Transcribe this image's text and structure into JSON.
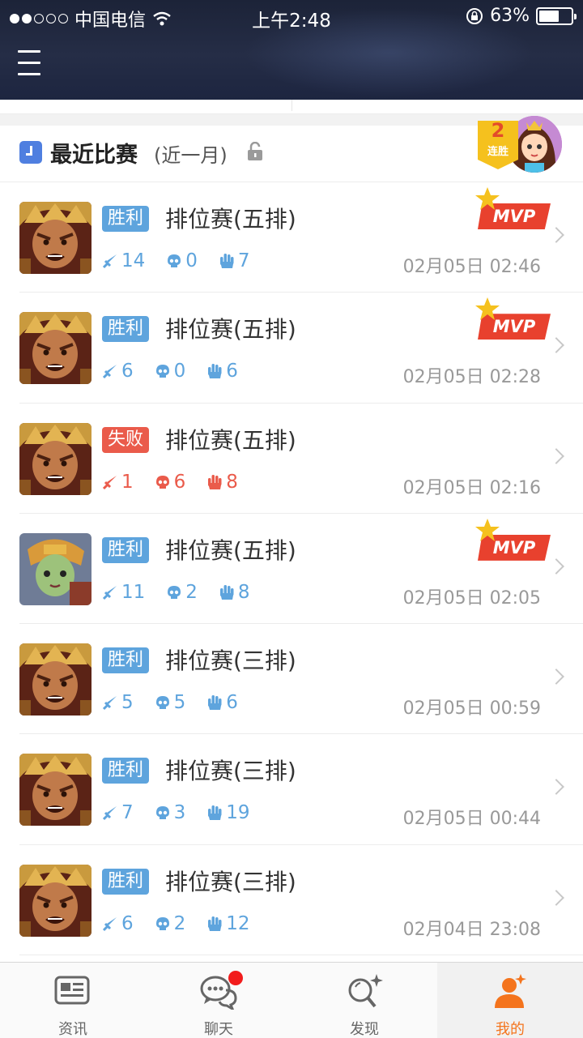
{
  "status_bar": {
    "carrier": "中国电信",
    "time": "上午2:48",
    "battery": "63%",
    "battery_level": 0.63
  },
  "section": {
    "title": "最近比赛",
    "subtitle": "(近一月)",
    "streak_count": "2",
    "streak_label": "连胜"
  },
  "mvp_label": "MVP",
  "matches": [
    {
      "result": "胜利",
      "outcome": "win",
      "mode": "排位赛(五排)",
      "kills": "14",
      "deaths": "0",
      "assists": "7",
      "time": "02月05日 02:46",
      "mvp": true,
      "hero": "monkey"
    },
    {
      "result": "胜利",
      "outcome": "win",
      "mode": "排位赛(五排)",
      "kills": "6",
      "deaths": "0",
      "assists": "6",
      "time": "02月05日 02:28",
      "mvp": true,
      "hero": "monkey"
    },
    {
      "result": "失败",
      "outcome": "lose",
      "mode": "排位赛(五排)",
      "kills": "1",
      "deaths": "6",
      "assists": "8",
      "time": "02月05日 02:16",
      "mvp": false,
      "hero": "monkey"
    },
    {
      "result": "胜利",
      "outcome": "win",
      "mode": "排位赛(五排)",
      "kills": "11",
      "deaths": "2",
      "assists": "8",
      "time": "02月05日 02:05",
      "mvp": true,
      "hero": "girl"
    },
    {
      "result": "胜利",
      "outcome": "win",
      "mode": "排位赛(三排)",
      "kills": "5",
      "deaths": "5",
      "assists": "6",
      "time": "02月05日 00:59",
      "mvp": false,
      "hero": "monkey"
    },
    {
      "result": "胜利",
      "outcome": "win",
      "mode": "排位赛(三排)",
      "kills": "7",
      "deaths": "3",
      "assists": "19",
      "time": "02月05日 00:44",
      "mvp": false,
      "hero": "monkey"
    },
    {
      "result": "胜利",
      "outcome": "win",
      "mode": "排位赛(三排)",
      "kills": "6",
      "deaths": "2",
      "assists": "12",
      "time": "02月04日 23:08",
      "mvp": false,
      "hero": "monkey"
    }
  ],
  "tabs": [
    {
      "label": "资讯",
      "icon": "news-icon"
    },
    {
      "label": "聊天",
      "icon": "chat-icon"
    },
    {
      "label": "发现",
      "icon": "discover-icon"
    },
    {
      "label": "我的",
      "icon": "profile-icon"
    }
  ],
  "colors": {
    "win": "#5ea4dd",
    "lose": "#ea5b4b",
    "accent": "#f4741d",
    "mvp": "#e8412e"
  }
}
